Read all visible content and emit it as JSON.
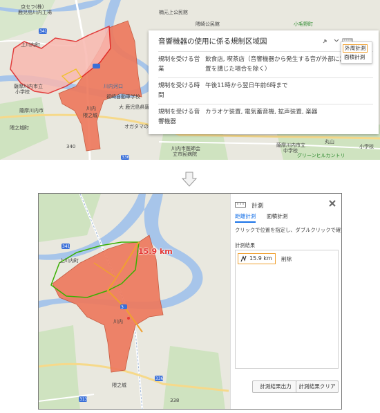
{
  "top_map": {
    "labels": [
      "京セラ(株)",
      "鹿児島川内工場",
      "341",
      "上川内町",
      "楠元上公民館",
      "隈崎公民館",
      "小毛野町",
      "薩摩川内市立",
      "小学校",
      "川内河口",
      "福崎自動車学校",
      "薩摩川内市",
      "川内",
      "隈之城",
      "隈之城町",
      "大 鹿児島県薩摩川内",
      "オガタマの木",
      "340",
      "336",
      "川内市医師会",
      "立市民病院",
      "丸山",
      "中学校",
      "薩摩川内市立",
      "グリーンヒルカントリ",
      "小学校"
    ],
    "info_panel": {
      "title": "音響機器の使用に係る規制区域図",
      "rows": [
        {
          "key": "規制を受ける営業",
          "value": "飲食店, 喫茶店（音響機器から発生する音が外部に漏れない措置を講じた場合を除く）"
        },
        {
          "key": "規制を受ける時間",
          "value": "午後11時から翌日午前6時まで"
        },
        {
          "key": "規制を受ける音響機器",
          "value": "カラオケ装置, 電気蓄音機, 拡声装置, 楽器"
        }
      ]
    },
    "measure_menu": {
      "outer": "外周計測",
      "area": "面積計測"
    }
  },
  "bottom_map": {
    "labels": [
      "341",
      "上川内町",
      "川内",
      "336",
      "隈之城",
      "313",
      "338",
      "3"
    ],
    "distance_label": "15.9 km",
    "panel": {
      "title": "計測",
      "tabs": [
        "距離計測",
        "面積計測"
      ],
      "help_text": "クリックで位置を指定し、ダブルクリックで確定します。",
      "results_label": "計測結果",
      "result_value": "15.9 km",
      "delete_label": "削除",
      "export_button": "計測結果出力",
      "clear_button": "計測結果クリア"
    }
  },
  "colors": {
    "region_fill": "#ee7a5e",
    "region_stroke": "#c45236",
    "selected_fill": "#f9b8b0",
    "selected_stroke": "#e02020",
    "measure_line": "#f0a030",
    "measure_outline": "#38b000",
    "river": "#a7c5ea",
    "accent": "#f0a030"
  }
}
